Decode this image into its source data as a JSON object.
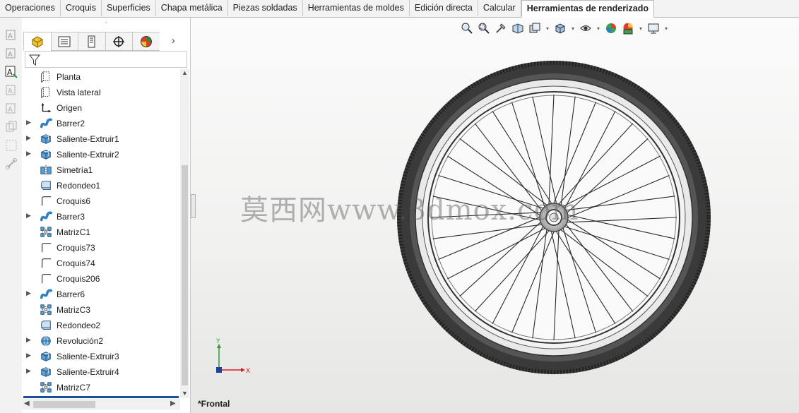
{
  "command_manager": {
    "tabs": [
      {
        "label": "Operaciones"
      },
      {
        "label": "Croquis"
      },
      {
        "label": "Superficies"
      },
      {
        "label": "Chapa metálica"
      },
      {
        "label": "Piezas soldadas"
      },
      {
        "label": "Herramientas de moldes"
      },
      {
        "label": "Edición directa"
      },
      {
        "label": "Calcular"
      },
      {
        "label": "Herramientas de renderizado"
      }
    ],
    "active_tab": "Herramientas de renderizado"
  },
  "feature_manager": {
    "grip": "◦",
    "tabs": [
      "feature-tree-tab",
      "property-manager-tab",
      "configuration-manager-tab",
      "dimxpert-manager-tab",
      "display-manager-tab"
    ],
    "more_label": "›",
    "tree": [
      {
        "label": "Planta",
        "icon": "plane-icon",
        "expandable": false
      },
      {
        "label": "Vista lateral",
        "icon": "plane-icon",
        "expandable": false
      },
      {
        "label": "Origen",
        "icon": "origin-icon",
        "expandable": false
      },
      {
        "label": "Barrer2",
        "icon": "sweep-icon",
        "expandable": true
      },
      {
        "label": "Saliente-Extruir1",
        "icon": "extrude-icon",
        "expandable": true
      },
      {
        "label": "Saliente-Extruir2",
        "icon": "extrude-icon",
        "expandable": true
      },
      {
        "label": "Simetría1",
        "icon": "mirror-icon",
        "expandable": false
      },
      {
        "label": "Redondeo1",
        "icon": "fillet-icon",
        "expandable": false
      },
      {
        "label": "Croquis6",
        "icon": "sketch-icon",
        "expandable": false
      },
      {
        "label": "Barrer3",
        "icon": "sweep-icon",
        "expandable": true
      },
      {
        "label": "MatrizC1",
        "icon": "pattern-icon",
        "expandable": false
      },
      {
        "label": "Croquis73",
        "icon": "sketch-icon",
        "expandable": false
      },
      {
        "label": "Croquis74",
        "icon": "sketch-icon",
        "expandable": false
      },
      {
        "label": "Croquis206",
        "icon": "sketch-icon",
        "expandable": false
      },
      {
        "label": "Barrer6",
        "icon": "sweep-icon",
        "expandable": true
      },
      {
        "label": "MatrizC3",
        "icon": "pattern-icon",
        "expandable": false
      },
      {
        "label": "Redondeo2",
        "icon": "fillet-icon",
        "expandable": false
      },
      {
        "label": "Revolución2",
        "icon": "revolve-icon",
        "expandable": true
      },
      {
        "label": "Saliente-Extruir3",
        "icon": "extrude-icon",
        "expandable": true
      },
      {
        "label": "Saliente-Extruir4",
        "icon": "extrude-icon",
        "expandable": true
      },
      {
        "label": "MatrizC7",
        "icon": "pattern-icon",
        "expandable": false
      }
    ]
  },
  "viewport": {
    "watermark": "莫西网www.3dmox.com",
    "view_name": "*Frontal",
    "triad": {
      "x_label": "X",
      "y_label": "Y"
    }
  },
  "colors": {
    "accent": "#1f4f9a",
    "icon_blue": "#2e7fc4",
    "tire": "#3a3a3a",
    "rim": "#e9e9e9"
  }
}
